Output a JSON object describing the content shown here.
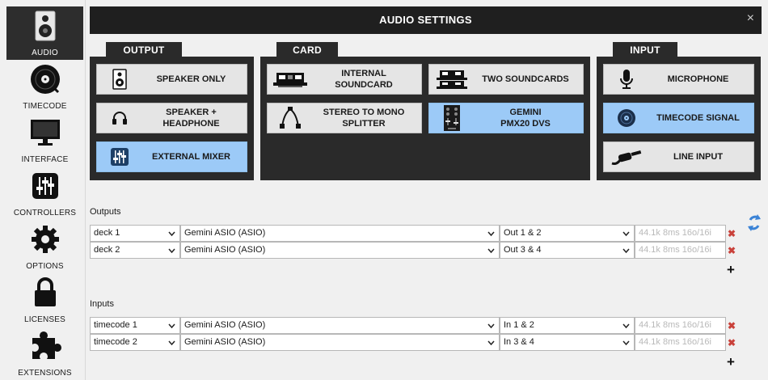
{
  "sidebar": {
    "items": [
      {
        "label": "AUDIO",
        "icon": "speaker-icon"
      },
      {
        "label": "TIMECODE",
        "icon": "vinyl-icon"
      },
      {
        "label": "INTERFACE",
        "icon": "monitor-icon"
      },
      {
        "label": "CONTROLLERS",
        "icon": "sliders-icon"
      },
      {
        "label": "OPTIONS",
        "icon": "gear-icon"
      },
      {
        "label": "LICENSES",
        "icon": "lock-icon"
      },
      {
        "label": "EXTENSIONS",
        "icon": "puzzle-icon"
      }
    ]
  },
  "header": {
    "title": "AUDIO SETTINGS",
    "close": "×"
  },
  "groups": {
    "output": {
      "title": "OUTPUT",
      "tiles": [
        {
          "label": "SPEAKER ONLY",
          "icon": "speaker-icon",
          "selected": false
        },
        {
          "label": "SPEAKER +\nHEADPHONE",
          "icon": "headphones-icon",
          "selected": false
        },
        {
          "label": "EXTERNAL MIXER",
          "icon": "mixer-icon",
          "selected": true
        }
      ]
    },
    "card": {
      "title": "CARD",
      "tiles": [
        {
          "label": "INTERNAL\nSOUNDCARD",
          "icon": "soundcard-icon",
          "selected": false
        },
        {
          "label": "TWO SOUNDCARDS",
          "icon": "soundcards-icon",
          "selected": false
        },
        {
          "label": "STEREO TO MONO\nSPLITTER",
          "icon": "splitter-cable-icon",
          "selected": false
        },
        {
          "label": "GEMINI\nPMX20 DVS",
          "icon": "dj-mixer-icon",
          "selected": true
        }
      ]
    },
    "input": {
      "title": "INPUT",
      "tiles": [
        {
          "label": "MICROPHONE",
          "icon": "microphone-icon",
          "selected": false
        },
        {
          "label": "TIMECODE SIGNAL",
          "icon": "vinyl-icon",
          "selected": true
        },
        {
          "label": "LINE INPUT",
          "icon": "jack-cable-icon",
          "selected": false
        }
      ]
    }
  },
  "outputs": {
    "label": "Outputs",
    "rows": [
      {
        "channel": "deck 1",
        "device": "Gemini ASIO (ASIO)",
        "ports": "Out 1 & 2",
        "info": "44.1k 8ms 16o/16i"
      },
      {
        "channel": "deck 2",
        "device": "Gemini ASIO (ASIO)",
        "ports": "Out 3 & 4",
        "info": "44.1k 8ms 16o/16i"
      }
    ]
  },
  "inputs": {
    "label": "Inputs",
    "rows": [
      {
        "channel": "timecode 1",
        "device": "Gemini ASIO (ASIO)",
        "ports": "In 1 & 2",
        "info": "44.1k 8ms 16o/16i"
      },
      {
        "channel": "timecode 2",
        "device": "Gemini ASIO (ASIO)",
        "ports": "In 3 & 4",
        "info": "44.1k 8ms 16o/16i"
      }
    ]
  },
  "controls": {
    "delete_glyph": "✖",
    "add_glyph": "+"
  },
  "colors": {
    "selected": "#9ccaf7",
    "panel": "#2a2a2a",
    "delete": "#c9413a",
    "refresh": "#3b83d6"
  }
}
